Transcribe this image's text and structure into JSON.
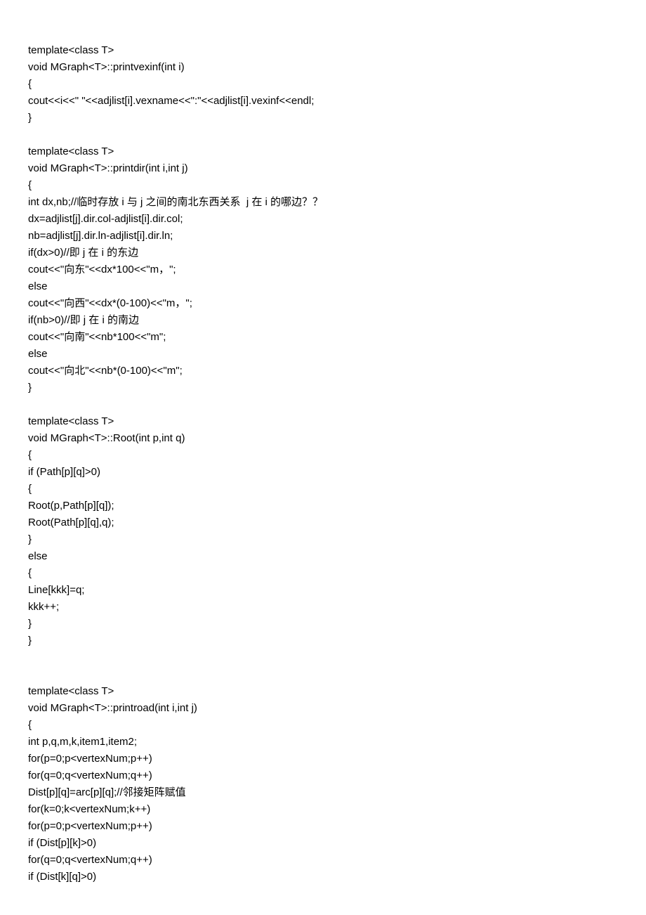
{
  "code_lines": [
    "template<class T>",
    "void MGraph<T>::printvexinf(int i)",
    "{",
    "cout<<i<<\" \"<<adjlist[i].vexname<<\":\"<<adjlist[i].vexinf<<endl;",
    "}",
    "",
    "template<class T>",
    "void MGraph<T>::printdir(int i,int j)",
    "{",
    "int dx,nb;//临时存放 i 与 j 之间的南北东西关系  j 在 i 的哪边？？",
    "dx=adjlist[j].dir.col-adjlist[i].dir.col;",
    "nb=adjlist[j].dir.ln-adjlist[i].dir.ln;",
    "if(dx>0)//即 j 在 i 的东边",
    "cout<<\"向东\"<<dx*100<<\"m，\";",
    "else",
    "cout<<\"向西\"<<dx*(0-100)<<\"m，\";",
    "if(nb>0)//即 j 在 i 的南边",
    "cout<<\"向南\"<<nb*100<<\"m\";",
    "else",
    "cout<<\"向北\"<<nb*(0-100)<<\"m\";",
    "}",
    "",
    "template<class T>",
    "void MGraph<T>::Root(int p,int q)",
    "{",
    "if (Path[p][q]>0)",
    "{",
    "Root(p,Path[p][q]);",
    "Root(Path[p][q],q);",
    "}",
    "else",
    "{",
    "Line[kkk]=q;",
    "kkk++;",
    "}",
    "}",
    "",
    "",
    "template<class T>",
    "void MGraph<T>::printroad(int i,int j)",
    "{",
    "int p,q,m,k,item1,item2;",
    "for(p=0;p<vertexNum;p++)",
    "for(q=0;q<vertexNum;q++)",
    "Dist[p][q]=arc[p][q];//邻接矩阵赋值",
    "for(k=0;k<vertexNum;k++)",
    "for(p=0;p<vertexNum;p++)",
    "if (Dist[p][k]>0)",
    "for(q=0;q<vertexNum;q++)",
    "if (Dist[k][q]>0)"
  ]
}
